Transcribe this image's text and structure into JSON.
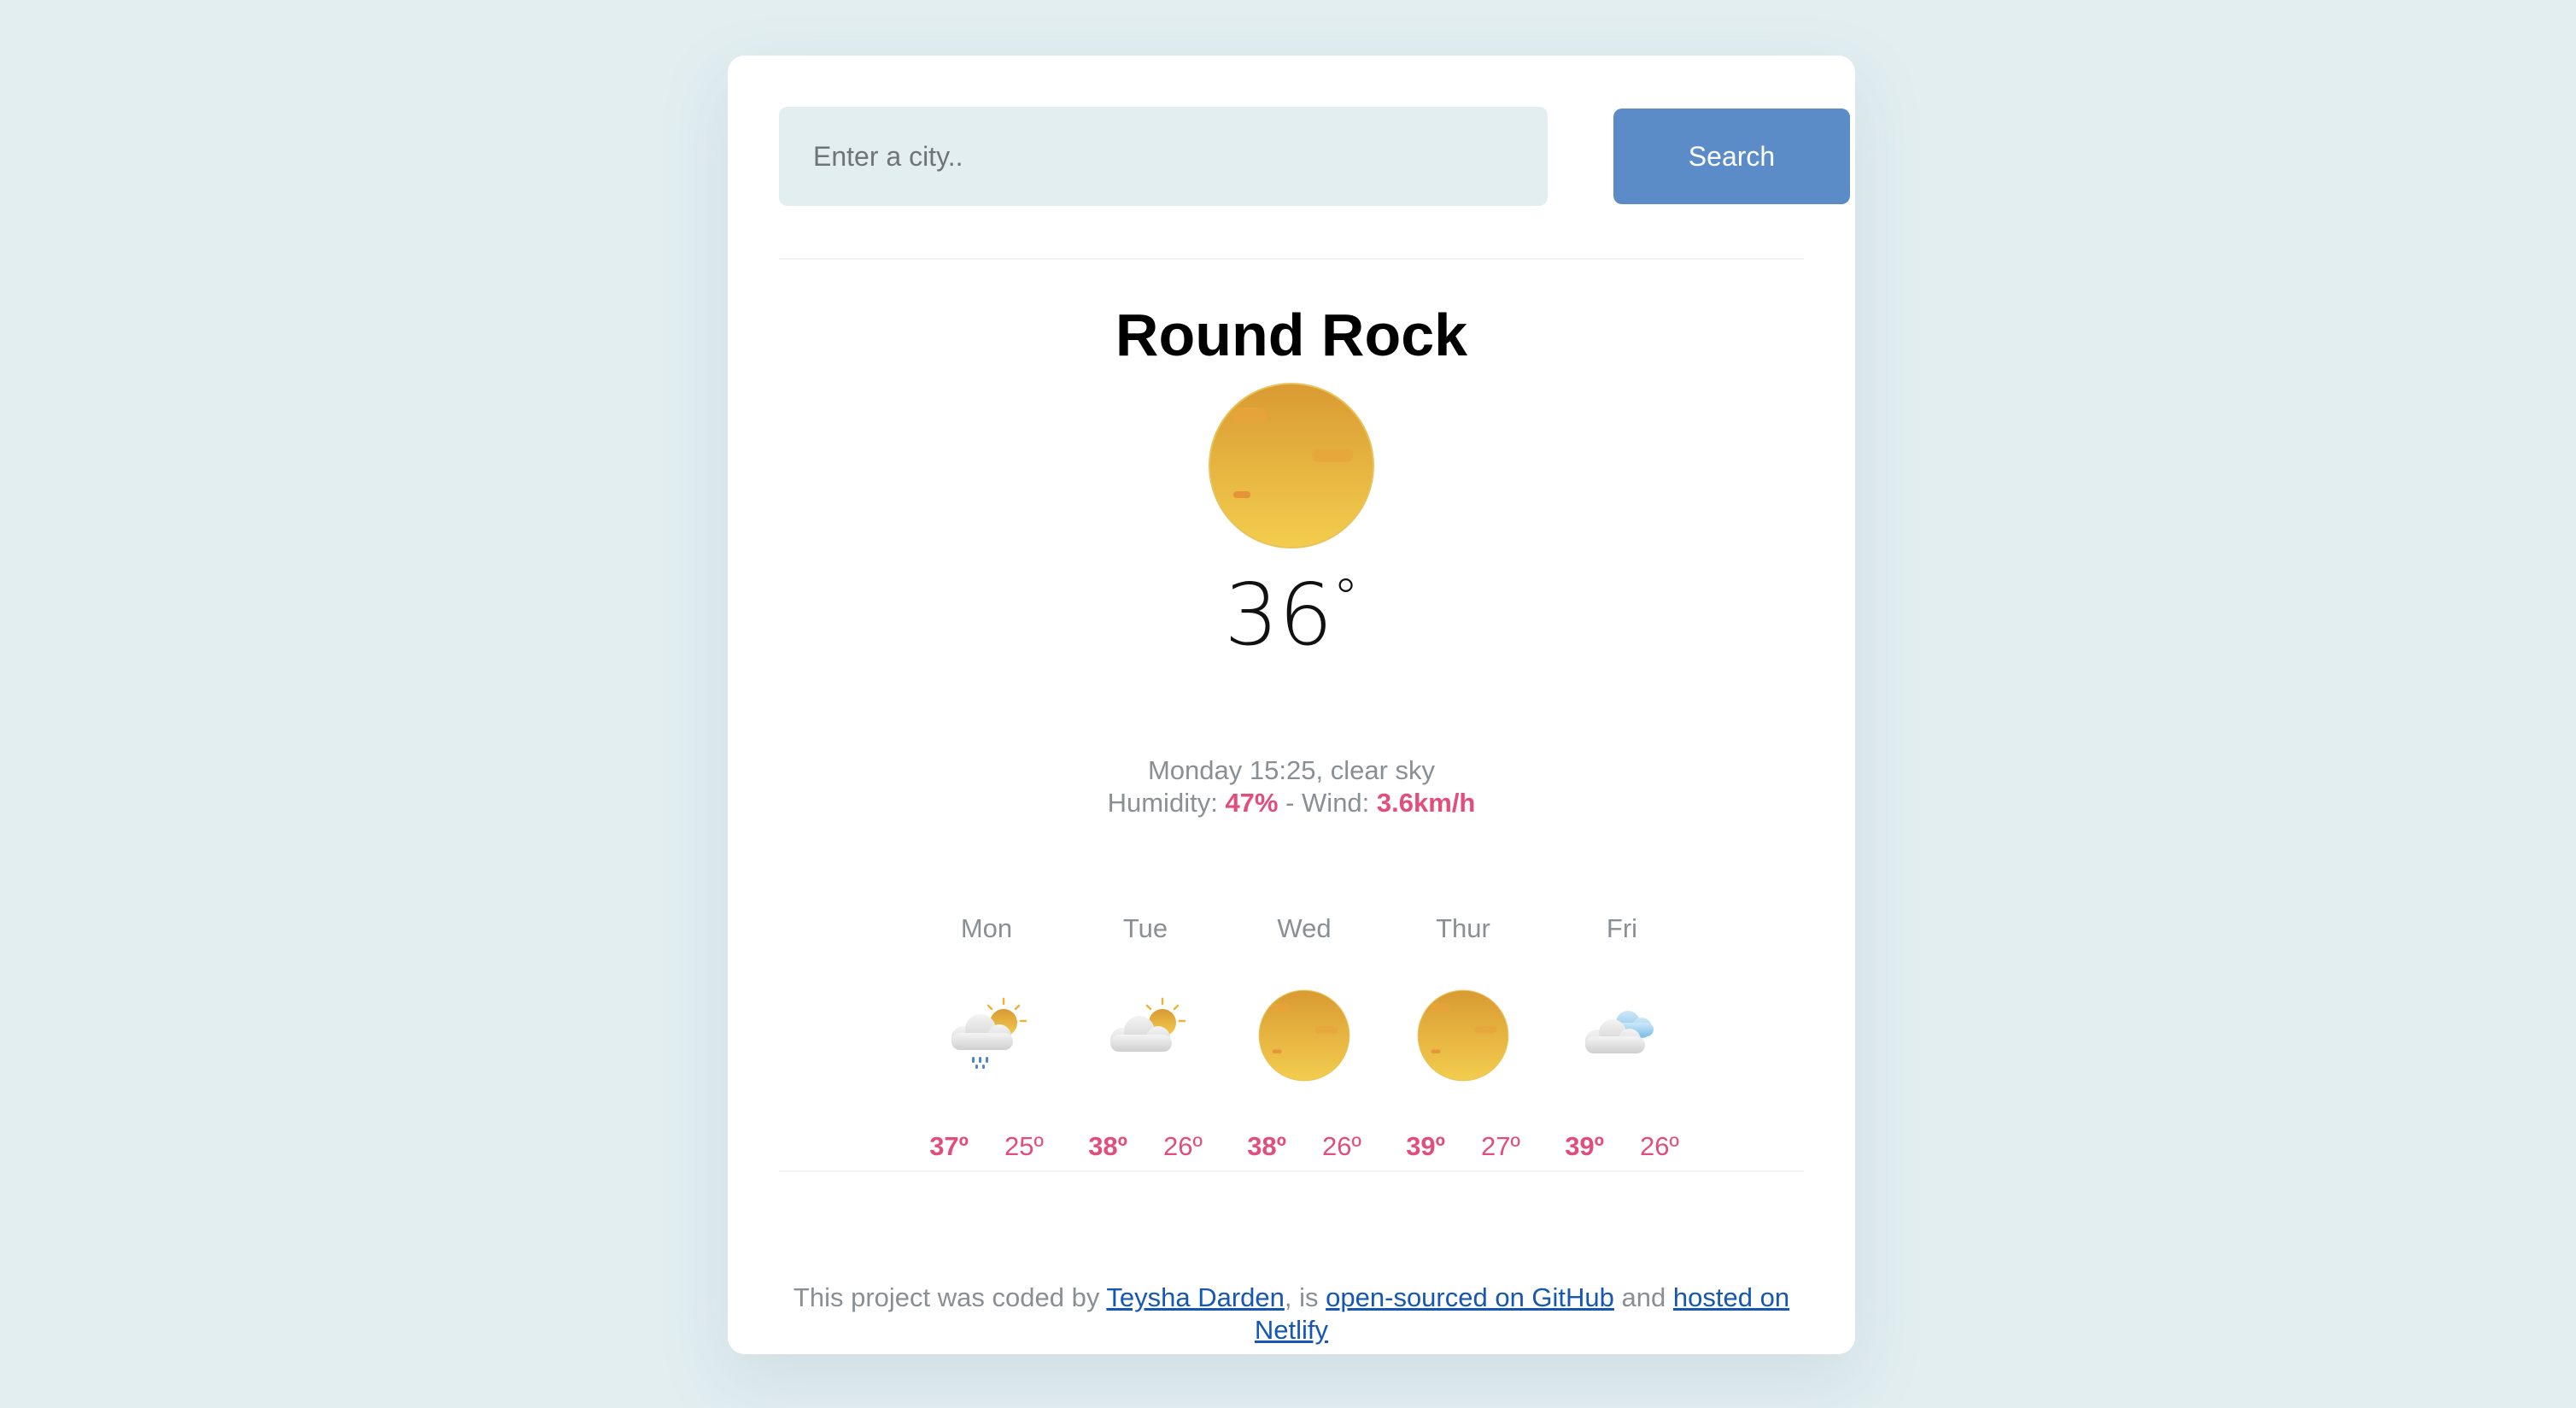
{
  "search": {
    "placeholder": "Enter a city..",
    "button_label": "Search"
  },
  "current": {
    "city": "Round Rock",
    "icon": "clear-sky-sun-icon",
    "temperature": "36",
    "unit": "°",
    "day_time": "Monday 15:25",
    "condition": "clear sky",
    "humidity_label": "Humidity:",
    "humidity": "47%",
    "separator": "- Wind:",
    "wind": "3.6km/h"
  },
  "forecast": [
    {
      "day": "Mon",
      "icon": "rain-sun-cloud-icon",
      "max": "37º",
      "min": "25º"
    },
    {
      "day": "Tue",
      "icon": "partly-cloudy-icon",
      "max": "38º",
      "min": "26º"
    },
    {
      "day": "Wed",
      "icon": "clear-sky-sun-icon",
      "max": "38º",
      "min": "26º"
    },
    {
      "day": "Thur",
      "icon": "clear-sky-sun-icon",
      "max": "39º",
      "min": "27º"
    },
    {
      "day": "Fri",
      "icon": "cloudy-icon",
      "max": "39º",
      "min": "26º"
    }
  ],
  "footer": {
    "prefix": "This project was coded by",
    "author_link": "Teysha Darden",
    "middle": ", is",
    "github_link": "open-sourced on GitHub",
    "and": "and",
    "netlify_link": "hosted on Netlify"
  },
  "colors": {
    "background": "#e2eef0",
    "accent": "#e24d7b",
    "button": "#5b8cc8",
    "link": "#1557b3"
  }
}
